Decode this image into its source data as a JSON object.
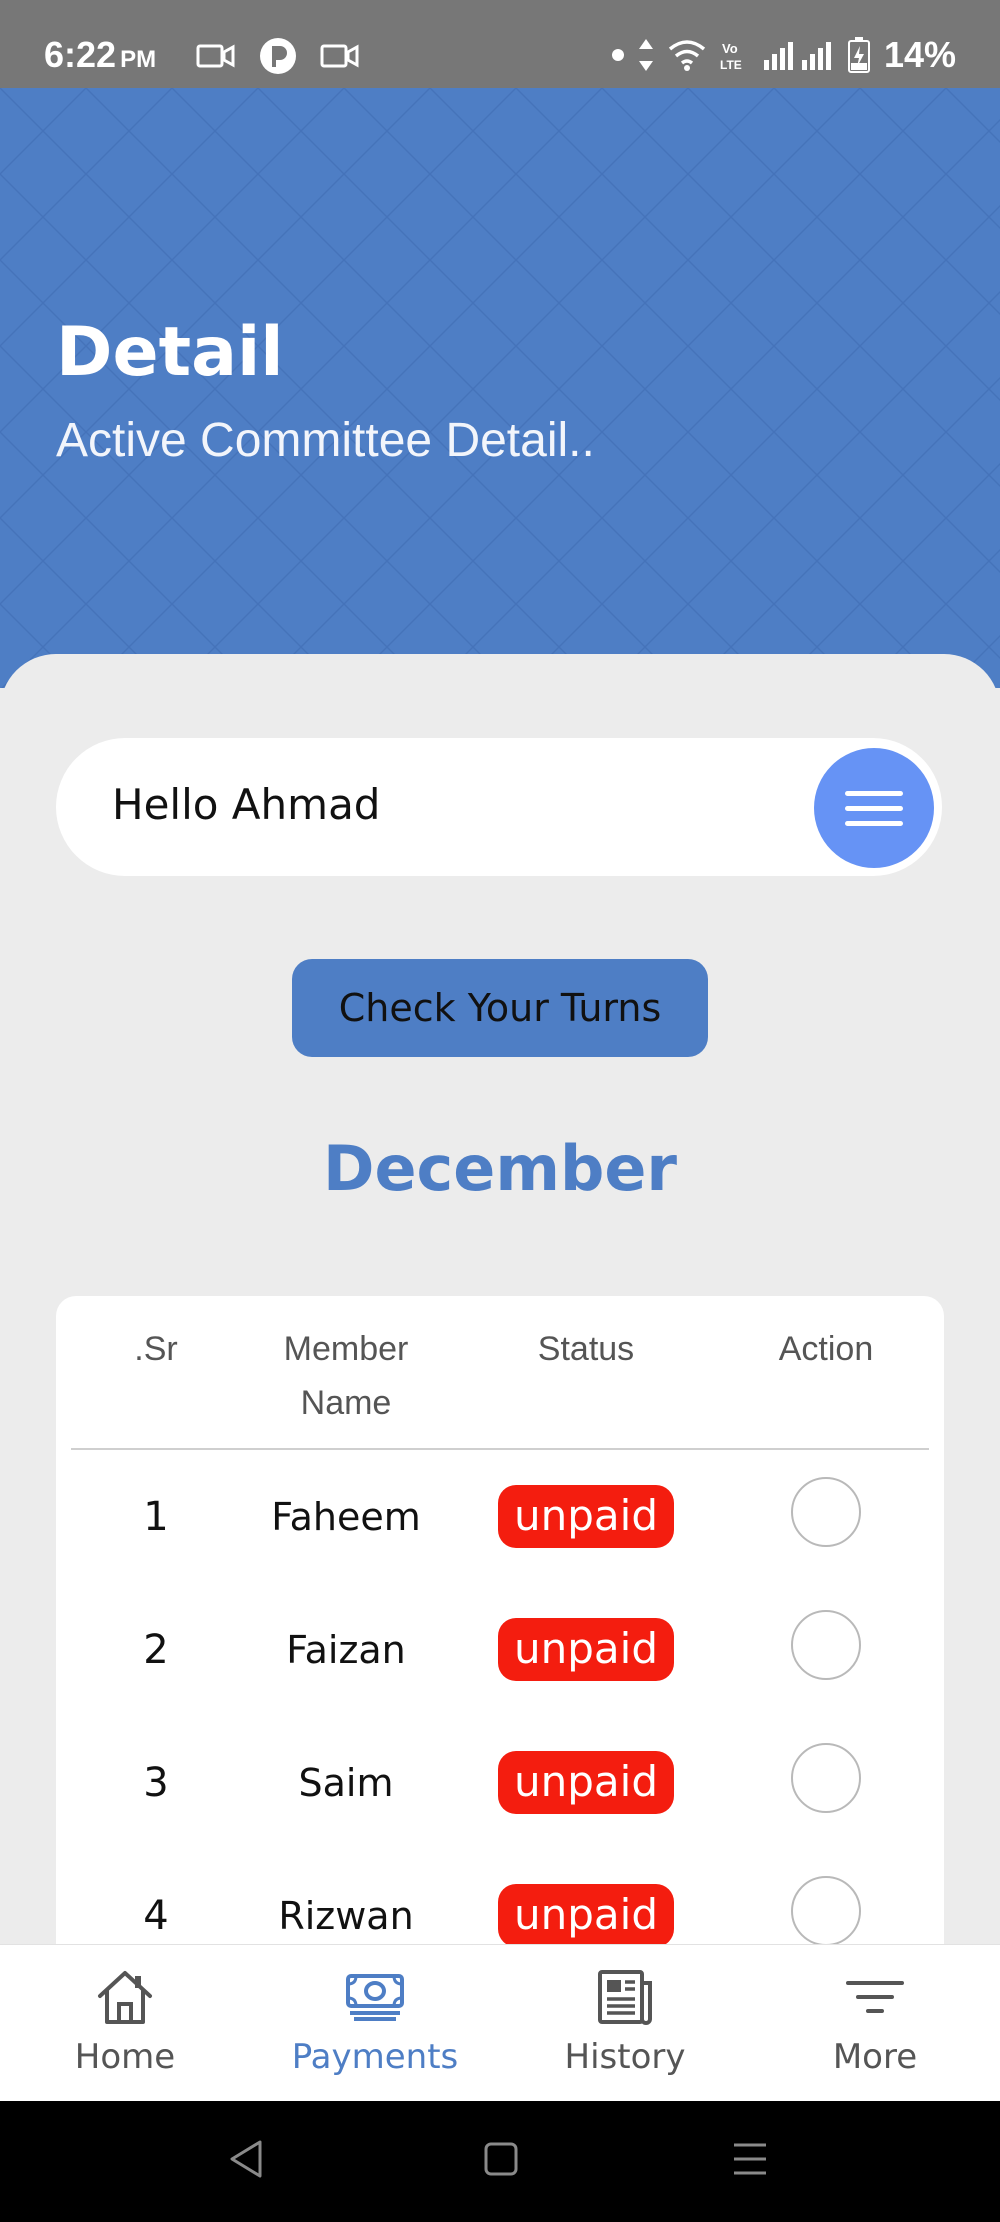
{
  "status_bar": {
    "time": "6:22",
    "ampm": "PM",
    "battery_percent": "14%"
  },
  "header": {
    "title": "Detail",
    "subtitle": "Active Committee Detail.."
  },
  "greeting": {
    "text": "Hello Ahmad"
  },
  "check_turns_button": "Check Your Turns",
  "month": "December",
  "table": {
    "columns": {
      "sr": ".Sr",
      "member_name": "Member\nName",
      "status": "Status",
      "action": "Action"
    },
    "rows": [
      {
        "sr": "1",
        "name": "Faheem",
        "status": "unpaid"
      },
      {
        "sr": "2",
        "name": "Faizan",
        "status": "unpaid"
      },
      {
        "sr": "3",
        "name": "Saim",
        "status": "unpaid"
      },
      {
        "sr": "4",
        "name": "Rizwan",
        "status": "unpaid"
      }
    ]
  },
  "bottom_nav": {
    "items": [
      {
        "label": "Home",
        "icon": "home-icon"
      },
      {
        "label": "Payments",
        "icon": "payments-icon",
        "active": true
      },
      {
        "label": "History",
        "icon": "history-icon"
      },
      {
        "label": "More",
        "icon": "more-filter-icon"
      }
    ]
  },
  "colors": {
    "primary": "#4e7ec5",
    "menu_button": "#6693f5",
    "unpaid_badge": "#f41d0f",
    "background": "#ececec"
  }
}
